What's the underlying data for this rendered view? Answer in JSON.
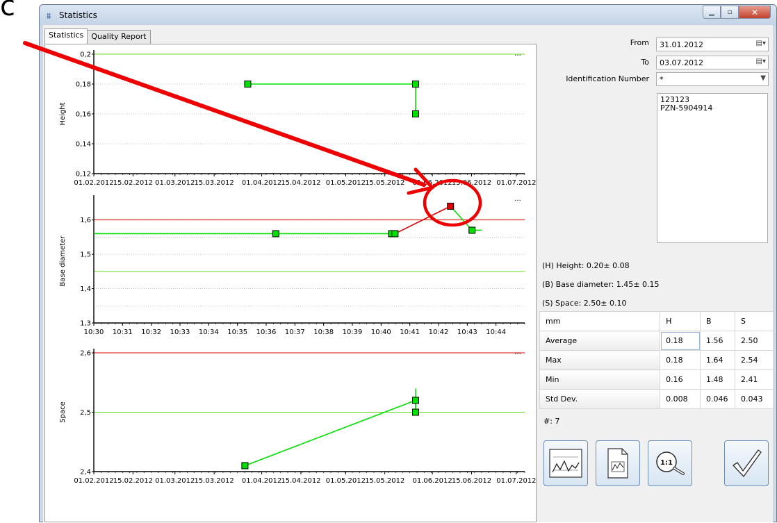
{
  "corner_glyph": "c",
  "window": {
    "title": "Statistics",
    "icon": "chart-icon"
  },
  "tabs": [
    {
      "label": "Statistics",
      "active": true
    },
    {
      "label": "Quality Report",
      "active": false
    }
  ],
  "form": {
    "from_label": "From",
    "from_value": "31.01.2012",
    "to_label": "To",
    "to_value": "03.07.2012",
    "id_label": "Identification Number",
    "id_value": "*",
    "list_items": [
      "123123",
      "PZN-5904914"
    ]
  },
  "specs": {
    "height": "(H) Height: 0.20± 0.08",
    "base": "(B) Base diameter: 1.45± 0.15",
    "space": "(S) Space: 2.50± 0.10"
  },
  "stats": {
    "headers": [
      "mm",
      "H",
      "B",
      "S"
    ],
    "rows": [
      {
        "label": "Average",
        "values": [
          "0.18",
          "1.56",
          "2.50"
        ]
      },
      {
        "label": "Max",
        "values": [
          "0.18",
          "1.64",
          "2.54"
        ]
      },
      {
        "label": "Min",
        "values": [
          "0.16",
          "1.48",
          "2.41"
        ]
      },
      {
        "label": "Std Dev.",
        "values": [
          "0.008",
          "0.046",
          "0.043"
        ]
      }
    ]
  },
  "count_text": "#:  7",
  "buttons": {
    "chart": "line-chart-icon",
    "report": "report-document-icon",
    "zoom": "zoom-1-1-icon",
    "ok": "checkmark-icon"
  },
  "colors": {
    "data": "#00e000",
    "limit": "#e00000",
    "target": "#66dd22",
    "out": "#e00000",
    "arrow": "#ee0000"
  },
  "chart_data": [
    {
      "type": "line",
      "ylabel": "Height",
      "ylim": [
        0.12,
        0.2
      ],
      "yticks": [
        "0,2",
        "0,18",
        "0,16",
        "0,14",
        "0,12"
      ],
      "xticks": [
        "01.02.2012",
        "15.02.2012",
        "01.03.2012",
        "15.03.2012",
        "01.04.2012",
        "15.04.2012",
        "01.05.2012",
        "15.05.2012",
        "01.06.2012",
        "15.06.2012",
        "01.07.2012"
      ],
      "xstart": "01.02.2012",
      "xend": "04.07.2012",
      "limits": {
        "upper": 0.2,
        "lower": 0.12
      },
      "grid": [
        0.18,
        0.16,
        0.14
      ],
      "points": [
        {
          "x": "27.03.2012",
          "y": 0.18
        },
        {
          "x": "26.05.2012",
          "y": 0.18
        },
        {
          "x": "26.05.2012",
          "y": 0.16
        }
      ],
      "menu": "..."
    },
    {
      "type": "line",
      "ylabel": "Base diameter",
      "ylim": [
        1.3,
        1.66
      ],
      "yticks": [
        "1,6",
        "1,5",
        "1,4",
        "1,3"
      ],
      "xticks": [
        "10:30",
        "10:31",
        "10:32",
        "10:33",
        "10:34",
        "10:35",
        "10:36",
        "10:37",
        "10:38",
        "10:39",
        "10:40",
        "10:41",
        "10:42",
        "10:43",
        "10:44"
      ],
      "xstart": "10:30",
      "xend": "10:45",
      "limits": {
        "upper": 1.6,
        "lower": 1.3
      },
      "target": 1.45,
      "grid": [
        1.55,
        1.5,
        1.4,
        1.35
      ],
      "points": [
        {
          "x": "10:30",
          "y": 1.56
        },
        {
          "x": "10:36:20",
          "y": 1.56
        },
        {
          "x": "10:40:22",
          "y": 1.56
        },
        {
          "x": "10:40:29",
          "y": 1.56
        },
        {
          "x": "10:42:25",
          "y": 1.64
        },
        {
          "x": "10:43:10",
          "y": 1.57
        },
        {
          "x": "10:43:30",
          "y": 1.57
        }
      ],
      "menu": "..."
    },
    {
      "type": "line",
      "ylabel": "Space",
      "ylim": [
        2.4,
        2.6
      ],
      "yticks": [
        "2,6",
        "2,5",
        "2,4"
      ],
      "xticks": [
        "01.02.2012",
        "15.02.2012",
        "01.03.2012",
        "15.03.2012",
        "01.04.2012",
        "15.04.2012",
        "01.05.2012",
        "15.05.2012",
        "01.06.2012",
        "15.06.2012",
        "01.07.2012"
      ],
      "xstart": "01.02.2012",
      "xend": "04.07.2012",
      "limits": {
        "upper": 2.6,
        "lower": 2.4
      },
      "target": 2.5,
      "points": [
        {
          "x": "26.03.2012",
          "y": 2.41
        },
        {
          "x": "26.05.2012",
          "y": 2.52
        },
        {
          "x": "26.05.2012",
          "y": 2.5
        }
      ],
      "error_bar": {
        "x": "26.05.2012",
        "low": 2.5,
        "high": 2.54
      },
      "menu": "..."
    }
  ]
}
